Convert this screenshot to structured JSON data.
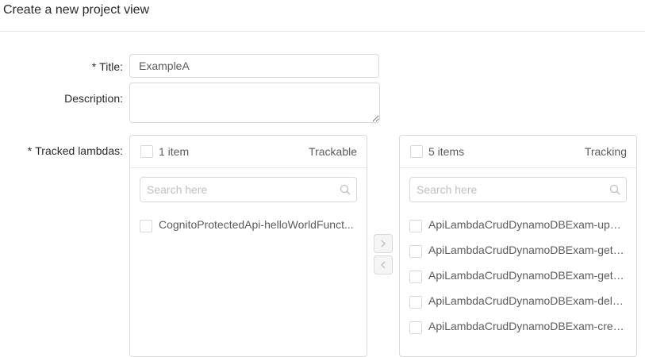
{
  "page": {
    "title": "Create a new project view"
  },
  "form": {
    "title": {
      "required_mark": "*",
      "label": "Title:",
      "value": "ExampleA"
    },
    "description": {
      "label": "Description:",
      "value": ""
    },
    "tracked_lambdas": {
      "required_mark": "*",
      "label": "Tracked lambdas:"
    }
  },
  "transfer": {
    "left": {
      "count_label": "1 item",
      "title": "Trackable",
      "search_placeholder": "Search here",
      "items": [
        "CognitoProtectedApi-helloWorldFunct..."
      ]
    },
    "right": {
      "count_label": "5 items",
      "title": "Tracking",
      "search_placeholder": "Search here",
      "items": [
        "ApiLambdaCrudDynamoDBExam-upda...",
        "ApiLambdaCrudDynamoDBExam-getO...",
        "ApiLambdaCrudDynamoDBExam-getA...",
        "ApiLambdaCrudDynamoDBExam-delet...",
        "ApiLambdaCrudDynamoDBExam-creat..."
      ]
    },
    "move_right_icon": "chevron-right-icon",
    "move_left_icon": "chevron-left-icon"
  }
}
